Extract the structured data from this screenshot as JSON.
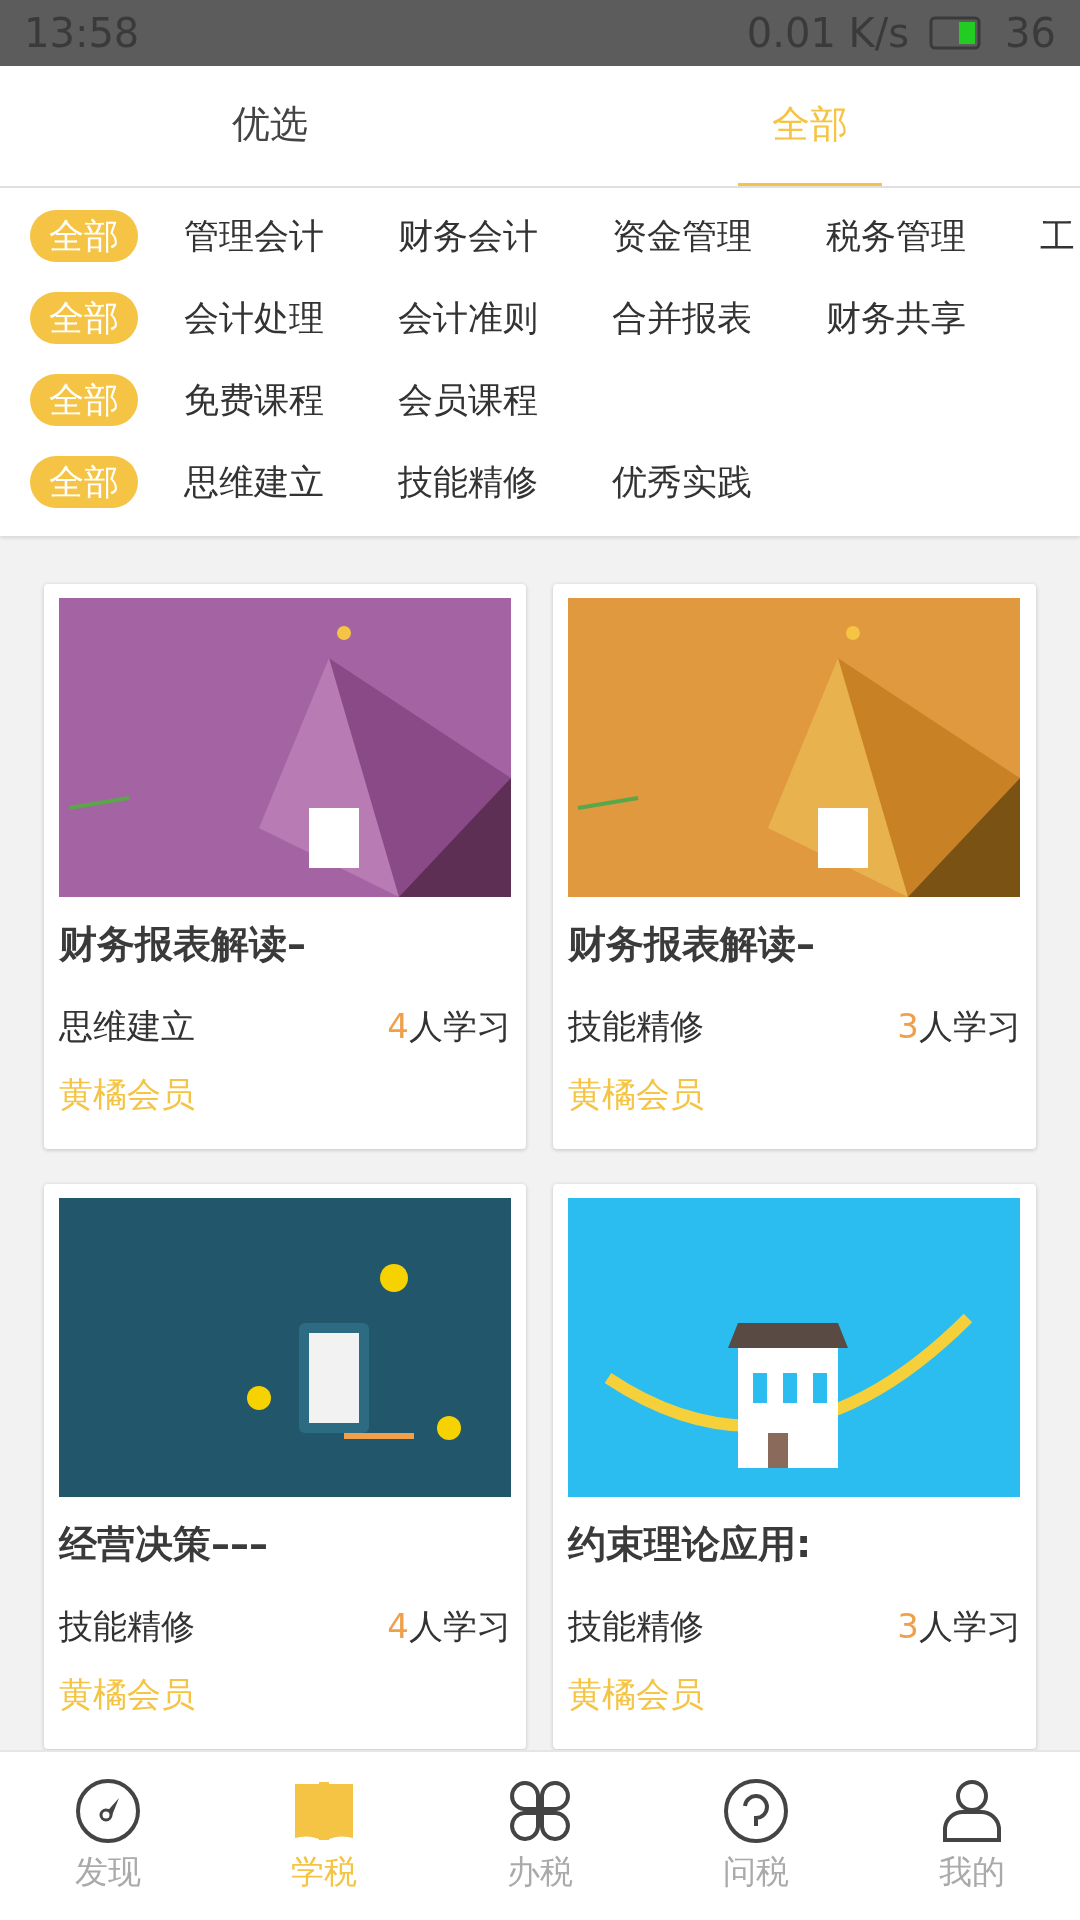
{
  "status_bar": {
    "time": "13:58",
    "speed": "0.01 K/s",
    "battery": "36"
  },
  "tabs": [
    {
      "label": "优选",
      "selected": false
    },
    {
      "label": "全部",
      "selected": true
    }
  ],
  "filters": [
    {
      "options": [
        {
          "label": "全部",
          "selected": true
        },
        {
          "label": "管理会计",
          "selected": false
        },
        {
          "label": "财务会计",
          "selected": false
        },
        {
          "label": "资金管理",
          "selected": false
        },
        {
          "label": "税务管理",
          "selected": false
        },
        {
          "label": "工",
          "selected": false
        }
      ]
    },
    {
      "options": [
        {
          "label": "全部",
          "selected": true
        },
        {
          "label": "会计处理",
          "selected": false
        },
        {
          "label": "会计准则",
          "selected": false
        },
        {
          "label": "合并报表",
          "selected": false
        },
        {
          "label": "财务共享",
          "selected": false
        }
      ]
    },
    {
      "options": [
        {
          "label": "全部",
          "selected": true
        },
        {
          "label": "免费课程",
          "selected": false
        },
        {
          "label": "会员课程",
          "selected": false
        }
      ]
    },
    {
      "options": [
        {
          "label": "全部",
          "selected": true
        },
        {
          "label": "思维建立",
          "selected": false
        },
        {
          "label": "技能精修",
          "selected": false
        },
        {
          "label": "优秀实践",
          "selected": false
        }
      ]
    }
  ],
  "courses": [
    {
      "title": "财务报表解读–",
      "category": "思维建立",
      "learners": "4",
      "learners_suffix": "人学习",
      "membership": "黄橘会员"
    },
    {
      "title": "财务报表解读–",
      "category": "技能精修",
      "learners": "3",
      "learners_suffix": "人学习",
      "membership": "黄橘会员"
    },
    {
      "title": "经营决策–––",
      "category": "技能精修",
      "learners": "4",
      "learners_suffix": "人学习",
      "membership": "黄橘会员"
    },
    {
      "title": "约束理论应用:",
      "category": "技能精修",
      "learners": "3",
      "learners_suffix": "人学习",
      "membership": "黄橘会员"
    }
  ],
  "bottom_nav": [
    {
      "label": "发现",
      "selected": false
    },
    {
      "label": "学税",
      "selected": true
    },
    {
      "label": "办税",
      "selected": false
    },
    {
      "label": "问税",
      "selected": false
    },
    {
      "label": "我的",
      "selected": false
    }
  ]
}
